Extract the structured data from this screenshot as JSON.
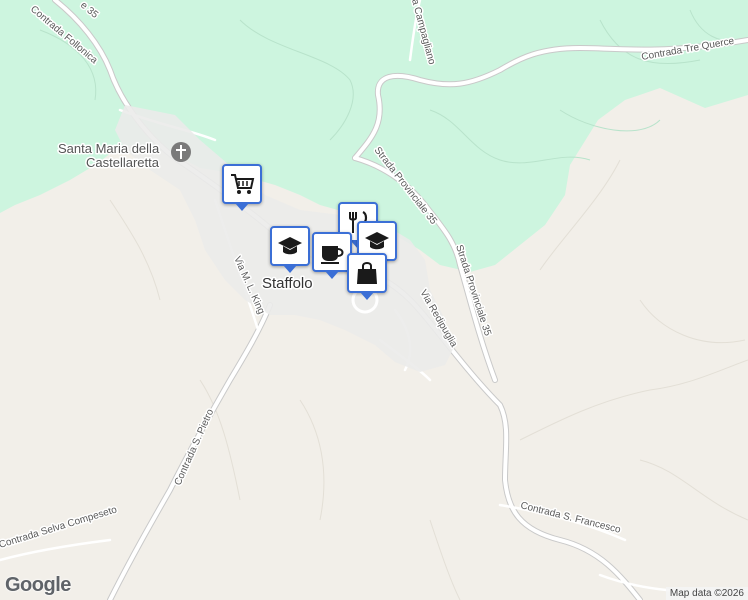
{
  "map": {
    "colors": {
      "land": "#f2efe9",
      "forest": "#cdf5df",
      "road": "#ffffff",
      "road_casing": "#c8c8c8",
      "marker": "#3b6fd6"
    },
    "labels": {
      "town": "Staffolo",
      "church": "Santa Maria della\nCastellaretta",
      "church_line1": "Santa Maria della",
      "church_line2": "Castellaretta",
      "roads": {
        "top_left_35": "e 35",
        "follonica": "Contrada Follonica",
        "campagliano": "a Campagliano",
        "tre_querce": "Contrada Tre Querce",
        "sp35_upper": "Strada Provinciale 35",
        "sp35_lower": "Strada Provinciale 35",
        "redipuglia": "Via Redipuglia",
        "king": "Via M. L. King",
        "s_pietro": "Contrada S. Pietro",
        "selva": "Contrada Selva Compeseto",
        "s_francesco": "Contrada S. Francesco"
      }
    },
    "markers": [
      {
        "icon": "shopping-cart-icon",
        "label": "supermarket"
      },
      {
        "icon": "graduation-cap-icon",
        "label": "school"
      },
      {
        "icon": "coffee-cup-icon",
        "label": "cafe"
      },
      {
        "icon": "fork-knife-icon",
        "label": "restaurant"
      },
      {
        "icon": "graduation-cap-icon",
        "label": "school"
      },
      {
        "icon": "shopping-bag-icon",
        "label": "shop"
      }
    ],
    "branding": "Google",
    "attribution": "Map data ©2026"
  }
}
